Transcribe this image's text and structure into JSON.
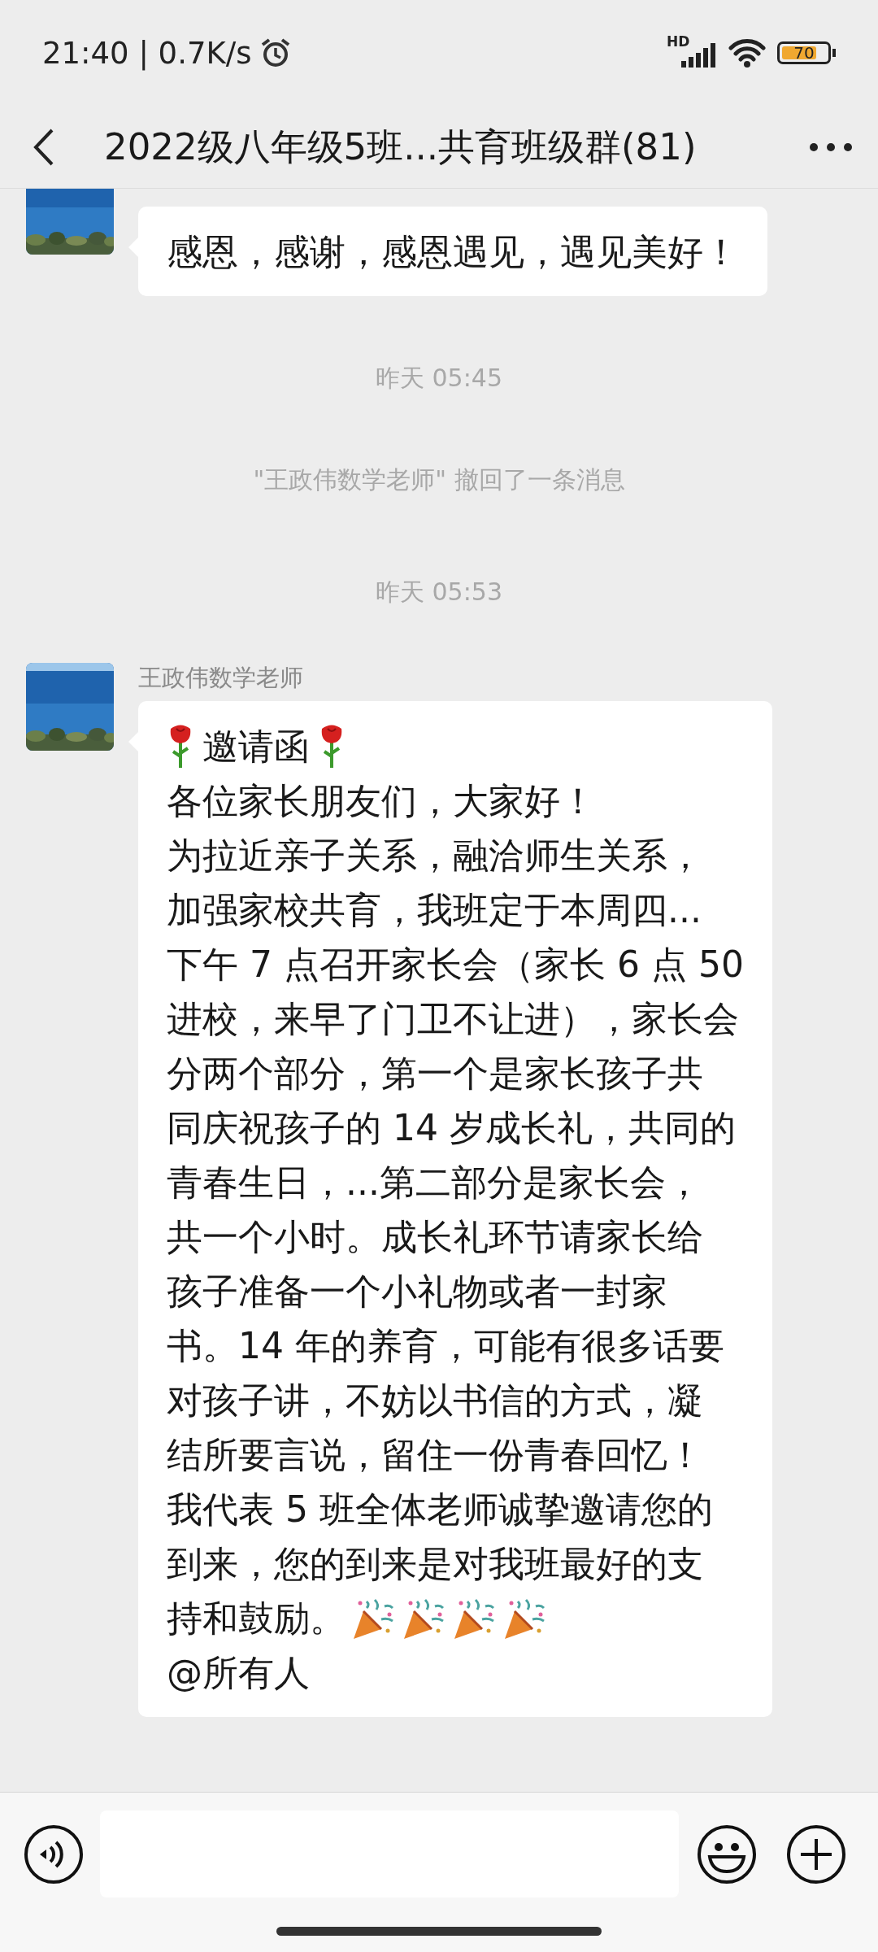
{
  "status_bar": {
    "time": "21:40 | 0.7K/s",
    "network": "HD",
    "battery": "70"
  },
  "header": {
    "title": "2022级八年级5班...共育班级群(81)"
  },
  "messages": [
    {
      "kind": "message",
      "lines": [
        {
          "kind": "text",
          "text": "感恩，感谢，感恩遇见，遇见美好！"
        }
      ]
    },
    {
      "kind": "time",
      "text": "昨天 05:45"
    },
    {
      "kind": "notice",
      "text": "\"王政伟数学老师\" 撤回了一条消息"
    },
    {
      "kind": "time",
      "text": "昨天 05:53"
    },
    {
      "kind": "message",
      "sender": "王政伟数学老师",
      "lines": [
        {
          "kind": "title",
          "text": "邀请函"
        },
        {
          "kind": "text",
          "text": "各位家长朋友们，大家好！"
        },
        {
          "kind": "text",
          "text": "为拉近亲子关系，融洽师生关系，"
        },
        {
          "kind": "text",
          "text": "加强家校共育，我班定于本周四..."
        },
        {
          "kind": "text",
          "text": "下午 7 点召开家长会（家长 6 点 50"
        },
        {
          "kind": "text",
          "text": "进校，来早了门卫不让进），家长会"
        },
        {
          "kind": "text",
          "text": "分两个部分，第一个是家长孩子共"
        },
        {
          "kind": "text",
          "text": "同庆祝孩子的 14 岁成长礼，共同的"
        },
        {
          "kind": "text",
          "text": "青春生日，...第二部分是家长会，"
        },
        {
          "kind": "text",
          "text": "共一个小时。成长礼环节请家长给"
        },
        {
          "kind": "text",
          "text": "孩子准备一个小礼物或者一封家"
        },
        {
          "kind": "text",
          "text": "书。14 年的养育，可能有很多话要"
        },
        {
          "kind": "text",
          "text": "对孩子讲，不妨以书信的方式，凝"
        },
        {
          "kind": "text",
          "text": "结所要言说，留住一份青春回忆！"
        },
        {
          "kind": "text",
          "text": "我代表 5 班全体老师诚挚邀请您的"
        },
        {
          "kind": "text",
          "text": "到来，您的到来是对我班最好的支"
        },
        {
          "kind": "celebration",
          "text": "持和鼓励。"
        },
        {
          "kind": "text",
          "text": "@所有人"
        }
      ]
    }
  ]
}
